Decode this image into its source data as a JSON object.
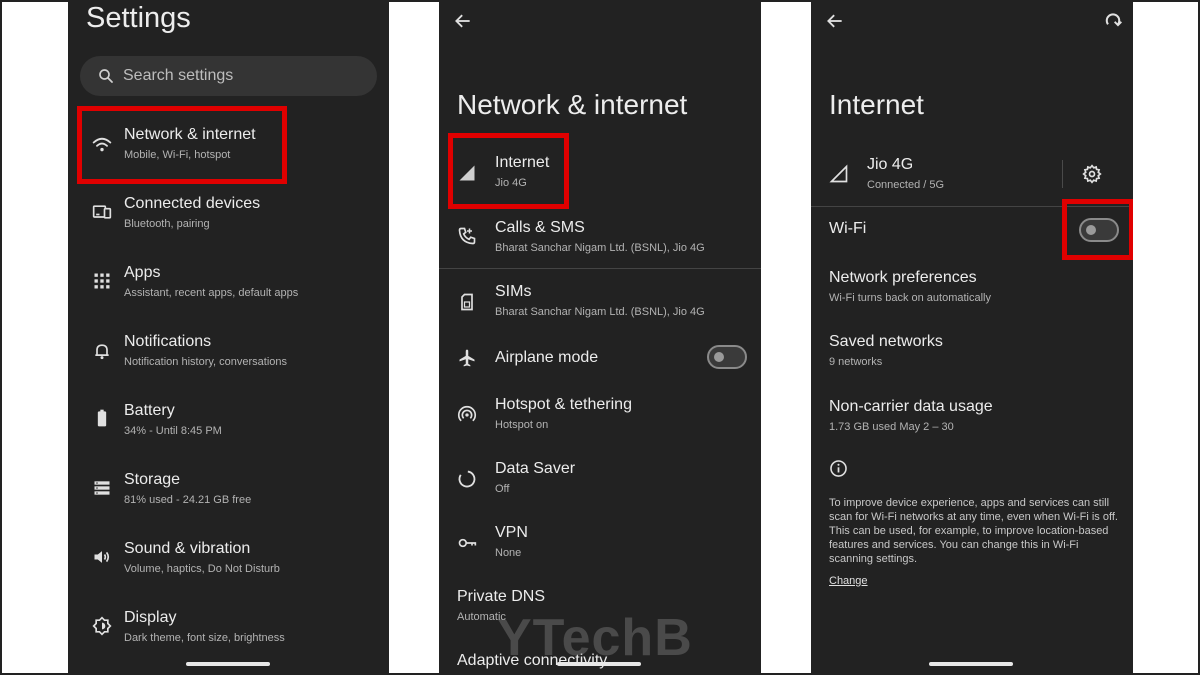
{
  "panel1": {
    "title": "Settings",
    "search_placeholder": "Search settings",
    "items": [
      {
        "title": "Network & internet",
        "subtitle": "Mobile, Wi-Fi, hotspot"
      },
      {
        "title": "Connected devices",
        "subtitle": "Bluetooth, pairing"
      },
      {
        "title": "Apps",
        "subtitle": "Assistant, recent apps, default apps"
      },
      {
        "title": "Notifications",
        "subtitle": "Notification history, conversations"
      },
      {
        "title": "Battery",
        "subtitle": "34% - Until 8:45 PM"
      },
      {
        "title": "Storage",
        "subtitle": "81% used - 24.21 GB free"
      },
      {
        "title": "Sound & vibration",
        "subtitle": "Volume, haptics, Do Not Disturb"
      },
      {
        "title": "Display",
        "subtitle": "Dark theme, font size, brightness"
      }
    ]
  },
  "panel2": {
    "title": "Network & internet",
    "items": [
      {
        "title": "Internet",
        "subtitle": "Jio 4G"
      },
      {
        "title": "Calls & SMS",
        "subtitle": "Bharat Sanchar Nigam Ltd. (BSNL), Jio 4G"
      },
      {
        "title": "SIMs",
        "subtitle": "Bharat Sanchar Nigam Ltd. (BSNL), Jio 4G"
      },
      {
        "title": "Airplane mode",
        "subtitle": ""
      },
      {
        "title": "Hotspot & tethering",
        "subtitle": "Hotspot on"
      },
      {
        "title": "Data Saver",
        "subtitle": "Off"
      },
      {
        "title": "VPN",
        "subtitle": "None"
      },
      {
        "title": "Private DNS",
        "subtitle": "Automatic"
      },
      {
        "title": "Adaptive connectivity",
        "subtitle": ""
      }
    ],
    "watermark": "YTechB"
  },
  "panel3": {
    "title": "Internet",
    "network": {
      "title": "Jio 4G",
      "subtitle": "Connected / 5G"
    },
    "wifi_label": "Wi-Fi",
    "items": [
      {
        "title": "Network preferences",
        "subtitle": "Wi-Fi turns back on automatically"
      },
      {
        "title": "Saved networks",
        "subtitle": "9 networks"
      },
      {
        "title": "Non-carrier data usage",
        "subtitle": "1.73 GB used May 2 – 30"
      }
    ],
    "info_text": "To improve device experience, apps and services can still scan for Wi-Fi networks at any time, even when Wi-Fi is off. This can be used, for example, to improve location-based features and services. You can change this in Wi-Fi scanning settings.",
    "change_link": "Change"
  },
  "colors": {
    "background": "#222222",
    "highlight": "#e00000",
    "text": "#ececec",
    "subtext": "#b3b3b3"
  },
  "toggles": {
    "airplane_mode_on": false,
    "wifi_on": false
  }
}
